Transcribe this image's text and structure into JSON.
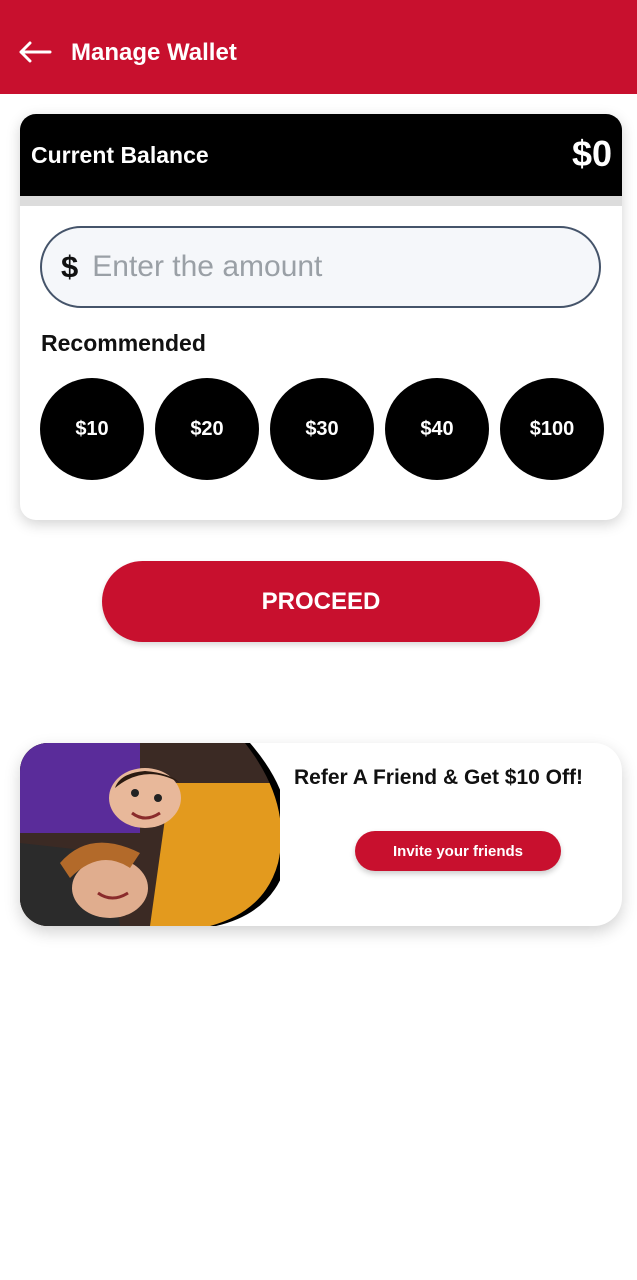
{
  "header": {
    "title": "Manage Wallet",
    "back_icon": "arrow-left-icon"
  },
  "balance": {
    "label": "Current Balance",
    "value": "$0"
  },
  "amount": {
    "currency_symbol": "$",
    "placeholder": "Enter the amount",
    "value": ""
  },
  "recommended": {
    "label": "Recommended",
    "options": [
      "$10",
      "$20",
      "$30",
      "$40",
      "$100"
    ]
  },
  "proceed": {
    "label": "PROCEED"
  },
  "referral": {
    "title": "Refer A Friend & Get $10 Off!",
    "button_label": "Invite your friends",
    "image": "friends-photo"
  },
  "colors": {
    "primary": "#c8102e",
    "balance_bar": "#000000",
    "chip": "#000000"
  }
}
